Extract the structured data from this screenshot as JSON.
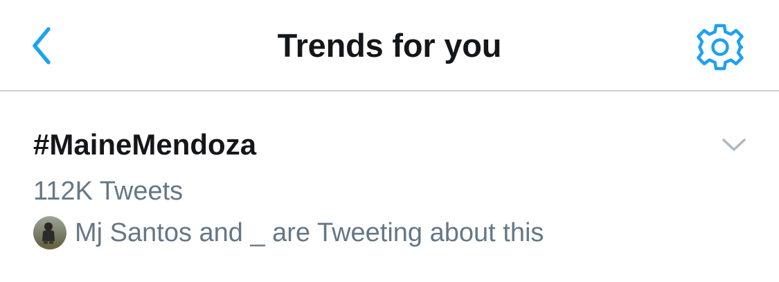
{
  "header": {
    "title": "Trends for you",
    "back_icon": "chevron-left-icon",
    "settings_icon": "gear-icon"
  },
  "trend": {
    "name": "#MaineMendoza",
    "tweet_count": "112K Tweets",
    "context": "Mj Santos and _ are Tweeting about this",
    "more_icon": "chevron-down-icon"
  },
  "colors": {
    "accent": "#1da1f2",
    "text_primary": "#14171a",
    "text_secondary": "#657786",
    "divider": "#c8cdd2"
  }
}
